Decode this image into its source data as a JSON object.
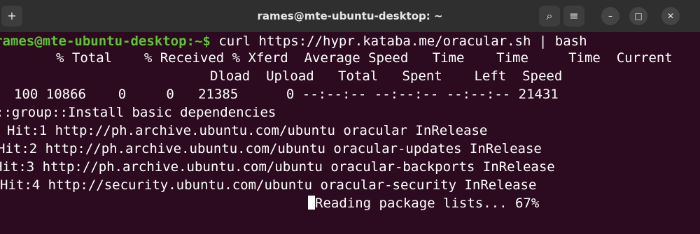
{
  "window": {
    "title": "rames@mte-ubuntu-desktop: ~",
    "newtab_glyph": "+",
    "search_glyph": "⌕",
    "menu_glyph": "≡",
    "minimize_glyph": "–",
    "maximize_glyph": "□",
    "close_glyph": "✕"
  },
  "terminal": {
    "prompt": "rames@mte-ubuntu-desktop:~$",
    "command": "curl https://hypr.kataba.me/oracular.sh | bash",
    "lines": [
      "% Total    % Received % Xferd  Average Speed   Time    Time     Time  Current",
      "Dload  Upload   Total   Spent    Left  Speed",
      "100 10866    0     0   21385      0 --:--:-- --:--:-- --:--:-- 21431",
      "::group::Install basic dependencies",
      "Hit:1 http://ph.archive.ubuntu.com/ubuntu oracular InRelease",
      "Hit:2 http://ph.archive.ubuntu.com/ubuntu oracular-updates InRelease",
      "Hit:3 http://ph.archive.ubuntu.com/ubuntu oracular-backports InRelease",
      "Hit:4 http://security.ubuntu.com/ubuntu oracular-security InRelease",
      "Reading package lists... 67%"
    ]
  },
  "colors": {
    "background": "#2c0a1f",
    "titlebar": "#2f2f2f",
    "prompt": "#5ec435",
    "text": "#ffffff"
  }
}
